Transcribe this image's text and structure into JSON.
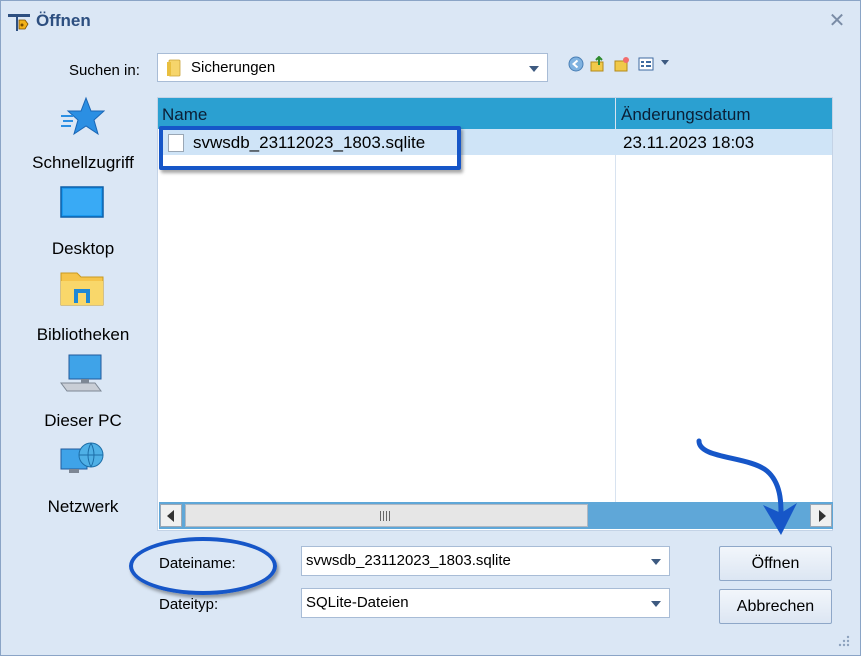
{
  "window": {
    "title": "Öffnen",
    "close_glyph": "✕"
  },
  "lookin": {
    "label": "Suchen in:",
    "value": "Sicherungen"
  },
  "nav_icons": [
    "back-icon",
    "up-folder-icon",
    "new-folder-icon",
    "view-menu-icon"
  ],
  "places": [
    {
      "label": "Schnellzugriff",
      "icon": "star-icon"
    },
    {
      "label": "Desktop",
      "icon": "desktop-icon"
    },
    {
      "label": "Bibliotheken",
      "icon": "libraries-icon"
    },
    {
      "label": "Dieser PC",
      "icon": "computer-icon"
    },
    {
      "label": "Netzwerk",
      "icon": "network-icon"
    }
  ],
  "list": {
    "columns": {
      "name": "Name",
      "date": "Änderungsdatum"
    },
    "rows": [
      {
        "name": "svwsdb_23112023_1803.sqlite",
        "date": "23.11.2023 18:03"
      }
    ]
  },
  "filename": {
    "label": "Dateiname:",
    "value": "svwsdb_23112023_1803.sqlite"
  },
  "filetype": {
    "label": "Dateityp:",
    "value": "SQLite-Dateien"
  },
  "buttons": {
    "open": "Öffnen",
    "cancel": "Abbrechen"
  },
  "colors": {
    "header": "#2ba0d1",
    "selection": "#cfe4f7",
    "annotation": "#1656c8",
    "dialog_bg": "#dbe7f5"
  }
}
